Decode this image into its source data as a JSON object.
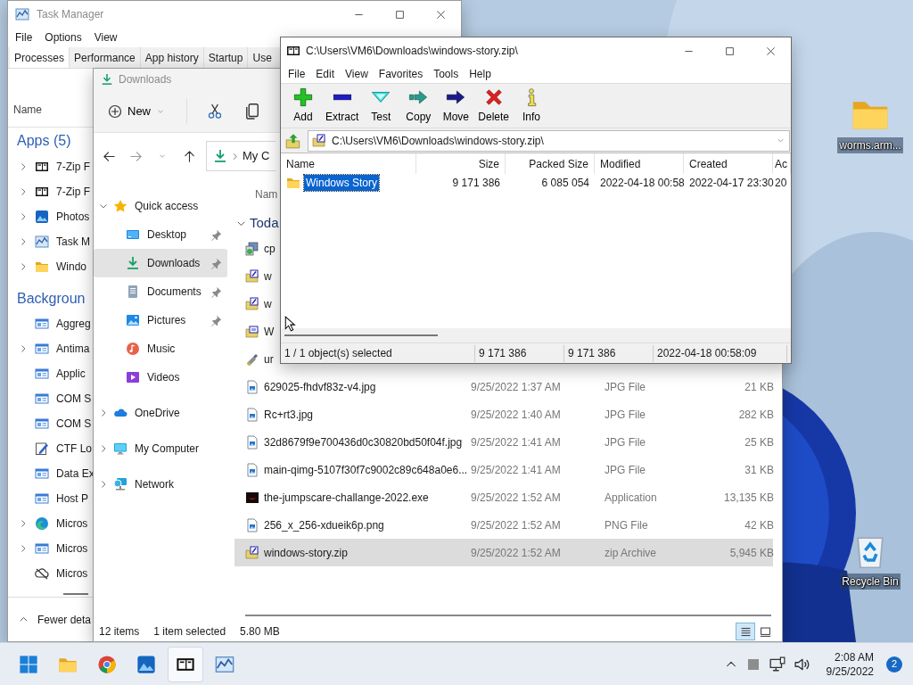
{
  "desktop_icons": [
    {
      "label": "worms.arm...",
      "kind": "folder"
    },
    {
      "label": "Recycle Bin",
      "kind": "recycle"
    }
  ],
  "task_manager": {
    "title": "Task Manager",
    "menu": [
      "File",
      "Options",
      "View"
    ],
    "tabs": [
      {
        "label": "Processes",
        "selected": true
      },
      {
        "label": "Performance",
        "selected": false
      },
      {
        "label": "App history",
        "selected": false
      },
      {
        "label": "Startup",
        "selected": false
      },
      {
        "label": "Use",
        "selected": false
      }
    ],
    "column": "Name",
    "groups": [
      {
        "heading": "Apps (5)",
        "rows": [
          {
            "name": "7-Zip F",
            "kind": "sevenzip",
            "expandable": true
          },
          {
            "name": "7-Zip F",
            "kind": "sevenzip",
            "expandable": true
          },
          {
            "name": "Photos",
            "kind": "photos",
            "expandable": true
          },
          {
            "name": "Task M",
            "kind": "chart",
            "expandable": true
          },
          {
            "name": "Windo",
            "kind": "folder",
            "expandable": true
          }
        ]
      },
      {
        "heading": "Backgroun",
        "rows": [
          {
            "name": "Aggreg",
            "kind": "service",
            "expandable": false
          },
          {
            "name": "Antima",
            "kind": "service",
            "expandable": true
          },
          {
            "name": "Applic",
            "kind": "service",
            "expandable": false
          },
          {
            "name": "COM S",
            "kind": "service",
            "expandable": false
          },
          {
            "name": "COM S",
            "kind": "service",
            "expandable": false
          },
          {
            "name": "CTF Lo",
            "kind": "pen",
            "expandable": false
          },
          {
            "name": "Data Ex",
            "kind": "service",
            "expandable": false
          },
          {
            "name": "Host P",
            "kind": "service",
            "expandable": false
          },
          {
            "name": "Micros",
            "kind": "edge",
            "expandable": true
          },
          {
            "name": "Micros",
            "kind": "service",
            "expandable": true
          },
          {
            "name": "Micros",
            "kind": "sync",
            "expandable": false
          }
        ]
      }
    ],
    "footer": "Fewer deta"
  },
  "explorer": {
    "title": "Downloads",
    "new_button": "New",
    "address": "My C",
    "sidebar": [
      {
        "label": "Quick access",
        "kind": "star",
        "expanded": true,
        "selected": false,
        "children": [
          {
            "label": "Desktop",
            "kind": "desktop",
            "pinned": true,
            "selected": false
          },
          {
            "label": "Downloads",
            "kind": "download",
            "pinned": true,
            "selected": true
          },
          {
            "label": "Documents",
            "kind": "documents",
            "pinned": true,
            "selected": false
          },
          {
            "label": "Pictures",
            "kind": "pictures",
            "pinned": true,
            "selected": false
          },
          {
            "label": "Music",
            "kind": "music",
            "pinned": false,
            "selected": false
          },
          {
            "label": "Videos",
            "kind": "videos",
            "pinned": false,
            "selected": false
          }
        ]
      },
      {
        "label": "OneDrive",
        "kind": "onedrive",
        "expanded": false,
        "selected": false
      },
      {
        "label": "My Computer",
        "kind": "computer",
        "expanded": false,
        "selected": false
      },
      {
        "label": "Network",
        "kind": "network",
        "expanded": false,
        "selected": false
      }
    ],
    "column": "Nam",
    "group": {
      "label": "Toda",
      "expanded": true
    },
    "files": [
      {
        "name": "cp",
        "kind": "setup",
        "selected": false
      },
      {
        "name": "w",
        "kind": "zip",
        "selected": false
      },
      {
        "name": "w",
        "kind": "zip",
        "selected": false
      },
      {
        "name": "W",
        "kind": "iso",
        "selected": false
      },
      {
        "name": "ur",
        "kind": "tool",
        "selected": false
      },
      {
        "name": "629025-fhdvf83z-v4.jpg",
        "date": "9/25/2022 1:37 AM",
        "type": "JPG File",
        "size": "21 KB",
        "kind": "jpg",
        "selected": false
      },
      {
        "name": "Rc+rt3.jpg",
        "date": "9/25/2022 1:40 AM",
        "type": "JPG File",
        "size": "282 KB",
        "kind": "jpg",
        "selected": false
      },
      {
        "name": "32d8679f9e700436d0c30820bd50f04f.jpg",
        "date": "9/25/2022 1:41 AM",
        "type": "JPG File",
        "size": "25 KB",
        "kind": "jpg",
        "selected": false
      },
      {
        "name": "main-qimg-5107f30f7c9002c89c648a0e6...",
        "date": "9/25/2022 1:41 AM",
        "type": "JPG File",
        "size": "31 KB",
        "kind": "jpg",
        "selected": false
      },
      {
        "name": "the-jumpscare-challange-2022.exe",
        "date": "9/25/2022 1:52 AM",
        "type": "Application",
        "size": "13,135 KB",
        "kind": "exe",
        "selected": false
      },
      {
        "name": "256_x_256-xdueik6p.png",
        "date": "9/25/2022 1:52 AM",
        "type": "PNG File",
        "size": "42 KB",
        "kind": "jpg",
        "selected": false
      },
      {
        "name": "windows-story.zip",
        "date": "9/25/2022 1:52 AM",
        "type": "zip Archive",
        "size": "5,945 KB",
        "kind": "zip",
        "selected": true
      }
    ],
    "status": {
      "count": "12 items",
      "selection": "1 item selected",
      "size": "5.80 MB"
    },
    "views": [
      {
        "kind": "details",
        "selected": true
      },
      {
        "kind": "tiles",
        "selected": false
      }
    ]
  },
  "sevenzip": {
    "title": "C:\\Users\\VM6\\Downloads\\windows-story.zip\\",
    "menu": [
      "File",
      "Edit",
      "View",
      "Favorites",
      "Tools",
      "Help"
    ],
    "tools": [
      {
        "label": "Add",
        "kind": "add"
      },
      {
        "label": "Extract",
        "kind": "extract"
      },
      {
        "label": "Test",
        "kind": "test"
      },
      {
        "label": "Copy",
        "kind": "copy"
      },
      {
        "label": "Move",
        "kind": "move"
      },
      {
        "label": "Delete",
        "kind": "delete"
      },
      {
        "label": "Info",
        "kind": "info"
      }
    ],
    "path": "C:\\Users\\VM6\\Downloads\\windows-story.zip\\",
    "columns": [
      "Name",
      "Size",
      "Packed Size",
      "Modified",
      "Created",
      "Ac"
    ],
    "rows": [
      {
        "cells": [
          "Windows Story",
          "9 171 386",
          "6 085 054",
          "2022-04-18 00:58",
          "2022-04-17 23:30",
          "20"
        ],
        "selected": true
      }
    ],
    "status": [
      "1 / 1 object(s) selected",
      "9 171 386",
      "9 171 386",
      "2022-04-18 00:58:09"
    ]
  },
  "taskbar": {
    "apps": [
      {
        "kind": "windows",
        "selected": false
      },
      {
        "kind": "folder",
        "selected": false
      },
      {
        "kind": "browser",
        "selected": false
      },
      {
        "kind": "photos",
        "selected": false
      },
      {
        "kind": "sevenzip",
        "selected": true
      },
      {
        "kind": "chart",
        "selected": false
      }
    ],
    "time": "2:08 AM",
    "date": "9/25/2022",
    "notifications": "2"
  }
}
